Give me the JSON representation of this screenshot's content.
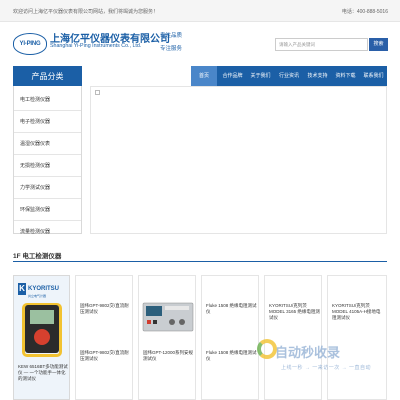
{
  "topbar": {
    "welcome": "欢迎访问上海亿平仪器仪表有限公司网站，我们将竭诚为您服务！",
    "phone": "电话：400-888-5016"
  },
  "header": {
    "logo_text": "YI-PING",
    "company_cn": "上海亿平仪器仪表有限公司",
    "company_en": "Shanghai Yi-Ping Instruments Co., Ltd.",
    "slogan1": "专注品质",
    "slogan2": "专注服务",
    "search_placeholder": "请输入产品关键词",
    "search_button": "搜索"
  },
  "nav": {
    "category_title": "产品分类",
    "items": [
      {
        "label": "首页",
        "active": true
      },
      {
        "label": "合作品牌",
        "active": false
      },
      {
        "label": "关于我们",
        "active": false
      },
      {
        "label": "行业资讯",
        "active": false
      },
      {
        "label": "技术支持",
        "active": false
      },
      {
        "label": "资料下载",
        "active": false
      },
      {
        "label": "联系我们",
        "active": false
      }
    ]
  },
  "sidebar": {
    "items": [
      {
        "label": "电工检测仪器"
      },
      {
        "label": "电子检测仪器"
      },
      {
        "label": "温湿仪器仪表"
      },
      {
        "label": "无损检测仪器"
      },
      {
        "label": "力学测试仪器"
      },
      {
        "label": "环保监测仪器"
      },
      {
        "label": "流量检测仪器"
      }
    ]
  },
  "section": {
    "title": "1F 电工检测仪器"
  },
  "promo": {
    "brand": "KYORITSU",
    "brand_sub": "共立电气计器",
    "caption": "KEW 6516BT多功能测试仪 — 一个功能手一体化的测试仪"
  },
  "cards": [
    {
      "title": "固纬GPT-9802交/直流耐压测试仪",
      "caption": "固纬GPT-9802交/直流耐压测试仪"
    },
    {
      "title": "",
      "caption": "固纬GPT-12000系列安规测试仪"
    },
    {
      "title": "Fluke 1508 绝缘电阻测试仪",
      "caption": "Fluke 1508 绝缘电阻测试仪"
    },
    {
      "title": "KYORITSU/克列茨MODEL 3165 绝缘电阻测试仪",
      "caption": ""
    },
    {
      "title": "KYORITSU/克列茨MODEL 4105A-H接地电阻测试仪",
      "caption": ""
    }
  ],
  "watermark": {
    "text": "自动秒收录",
    "sub": "上线一秒 → 一来访一次 → 一直自动"
  },
  "colors": {
    "brand_blue": "#1b5fa6",
    "nav_active": "#4a86c9",
    "search_button": "#2a5fa8"
  }
}
